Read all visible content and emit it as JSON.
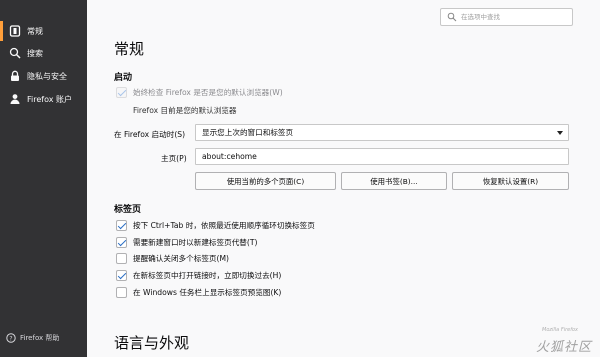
{
  "sidebar": {
    "items": [
      {
        "label": "常规",
        "icon": "general-icon",
        "selected": true
      },
      {
        "label": "搜索",
        "icon": "search-icon",
        "selected": false
      },
      {
        "label": "隐私与安全",
        "icon": "lock-icon",
        "selected": false
      },
      {
        "label": "Firefox 账户",
        "icon": "account-icon",
        "selected": false
      }
    ],
    "help_label": "Firefox 帮助"
  },
  "search": {
    "placeholder": "在选项中查找"
  },
  "main": {
    "title": "常规",
    "startup": {
      "heading": "启动",
      "default_check_label": "始终检查 Firefox 是否是您的默认浏览器(W)",
      "default_status": "Firefox 目前是您的默认浏览器",
      "startup_label": "在 Firefox 启动时(S)",
      "startup_value": "显示您上次的窗口和标签页",
      "home_label": "主页(P)",
      "home_value": "about:cehome",
      "buttons": {
        "use_current": "使用当前的多个页面(C)",
        "use_bookmark": "使用书签(B)...",
        "restore_default": "恢复默认设置(R)"
      }
    },
    "tabs": {
      "heading": "标签页",
      "options": [
        {
          "label": "按下 Ctrl+Tab 时，依照最近使用顺序循环切换标签页",
          "checked": true
        },
        {
          "label": "需要新建窗口时以新建标签页代替(T)",
          "checked": true
        },
        {
          "label": "提醒确认关闭多个标签页(M)",
          "checked": false
        },
        {
          "label": "在新标签页中打开链接时，立即切换过去(H)",
          "checked": true
        },
        {
          "label": "在 Windows 任务栏上显示标签页预览图(K)",
          "checked": false
        }
      ]
    },
    "language_heading": "语言与外观"
  },
  "watermark": {
    "small": "Mozilla Firefox",
    "big": "火狐社区"
  },
  "colors": {
    "sidebar_bg": "#323234",
    "selected_accent": "#ff9f3a",
    "page_bg": "#f9f9fa",
    "check_blue": "#2a6ec5"
  }
}
